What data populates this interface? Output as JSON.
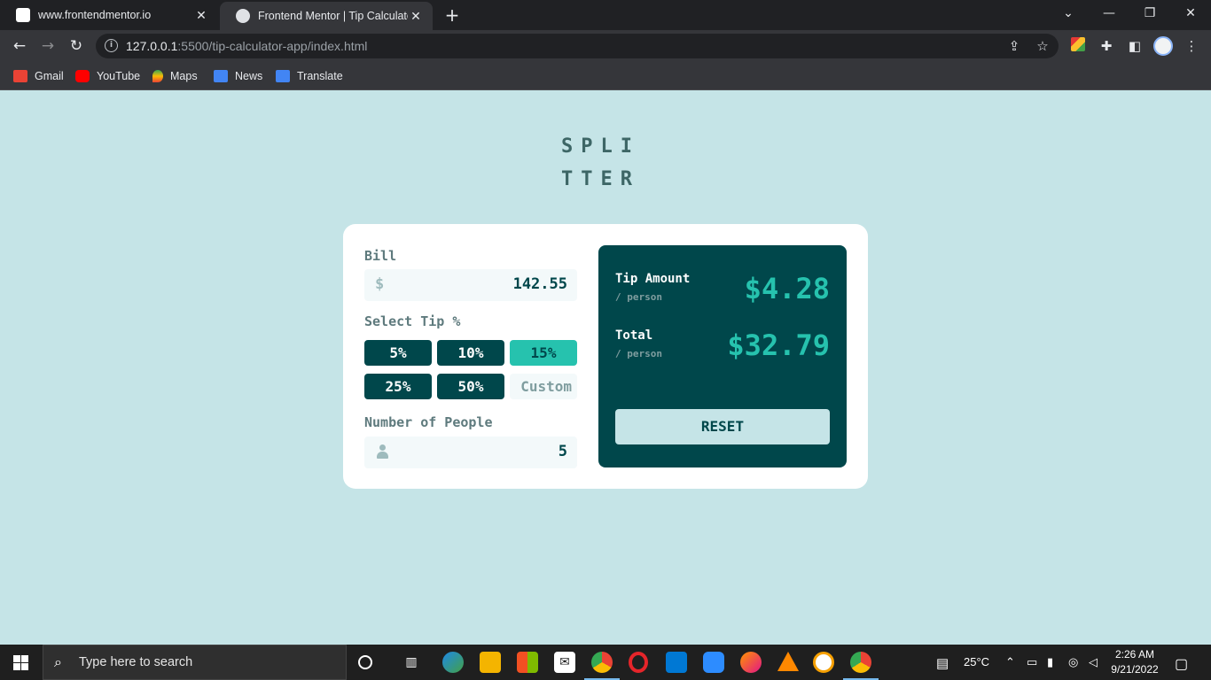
{
  "browser": {
    "tabs": [
      {
        "title": "www.frontendmentor.io",
        "active": false
      },
      {
        "title": "Frontend Mentor | Tip Calculator",
        "active": true
      }
    ],
    "url_host": "127.0.0.1",
    "url_rest": ":5500/tip-calculator-app/index.html",
    "bookmarks": [
      "Gmail",
      "YouTube",
      "Maps",
      "News",
      "Translate"
    ]
  },
  "app": {
    "logo_line1": "SPLI",
    "logo_line2": "TTER",
    "bill": {
      "label": "Bill",
      "currency_icon": "$",
      "value": "142.55"
    },
    "tip": {
      "label": "Select Tip %",
      "options": [
        "5%",
        "10%",
        "15%",
        "25%",
        "50%"
      ],
      "selected": "15%",
      "custom_placeholder": "Custom"
    },
    "people": {
      "label": "Number of People",
      "value": "5"
    },
    "results": {
      "tip_title": "Tip Amount",
      "tip_sub": "/ person",
      "tip_value": "$4.28",
      "total_title": "Total",
      "total_sub": "/ person",
      "total_value": "$32.79",
      "reset_label": "RESET"
    },
    "colors": {
      "background": "#c5e4e7",
      "dark_cyan": "#00474b",
      "strong_cyan": "#26c2ae"
    }
  },
  "taskbar": {
    "search_placeholder": "Type here to search",
    "weather": "25°C",
    "time": "2:26 AM",
    "date": "9/21/2022"
  }
}
